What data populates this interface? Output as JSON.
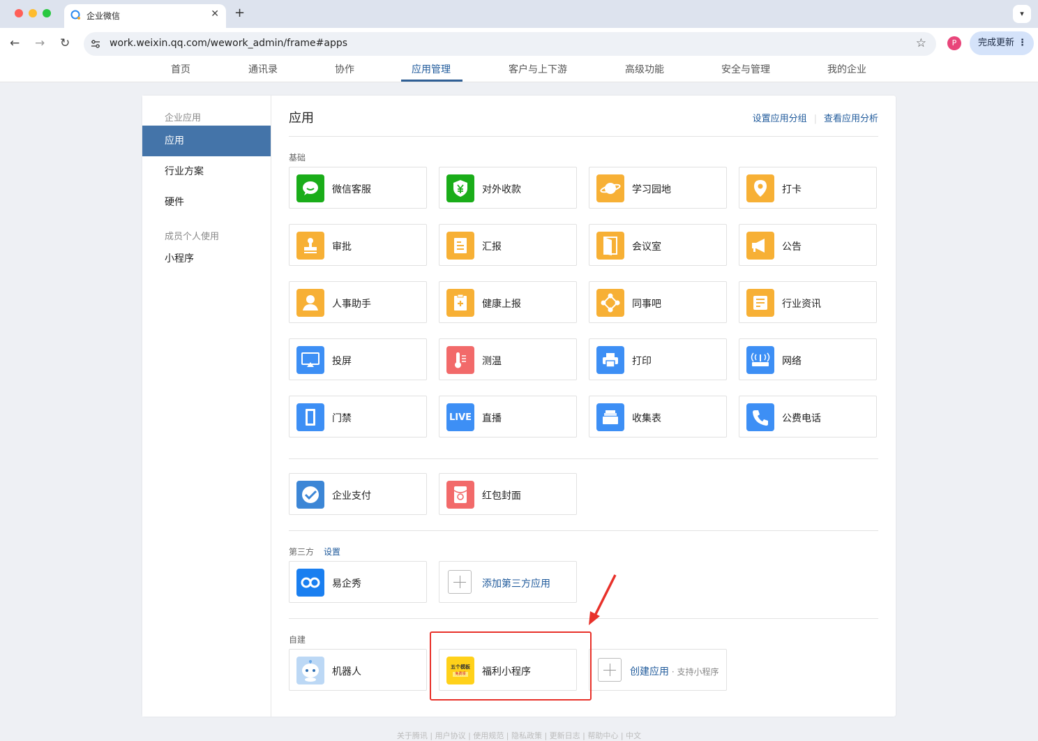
{
  "browser": {
    "tab_title": "企业微信",
    "url": "work.weixin.qq.com/wework_admin/frame#apps",
    "profile_initial": "P",
    "update_button": "完成更新"
  },
  "topnav": [
    "首页",
    "通讯录",
    "协作",
    "应用管理",
    "客户与上下游",
    "高级功能",
    "安全与管理",
    "我的企业"
  ],
  "sidebar": {
    "group1": "企业应用",
    "items": [
      "应用",
      "行业方案",
      "硬件"
    ],
    "group2": "成员个人使用",
    "item_mini": "小程序"
  },
  "main": {
    "title": "应用",
    "link_group": "设置应用分组",
    "link_analysis": "查看应用分析",
    "section_basic": "基础",
    "basic_apps": [
      "微信客服",
      "对外收款",
      "学习园地",
      "打卡",
      "审批",
      "汇报",
      "会议室",
      "公告",
      "人事助手",
      "健康上报",
      "同事吧",
      "行业资讯",
      "投屏",
      "测温",
      "打印",
      "网络",
      "门禁",
      "直播",
      "收集表",
      "公费电话"
    ],
    "pay_apps": [
      "企业支付",
      "红包封面"
    ],
    "section_third": "第三方",
    "third_settings": "设置",
    "third_apps": [
      "易企秀"
    ],
    "add_third": "添加第三方应用",
    "section_custom": "自建",
    "custom_apps": [
      "机器人",
      "福利小程序"
    ],
    "create_app": "创建应用",
    "create_app_sub": " · 支持小程序",
    "live_badge": "LIVE",
    "welfare_icon_text": "五个模板",
    "welfare_icon_sub": "免费领"
  },
  "colors": {
    "accent": "#4474a9",
    "link": "#1f5a9b",
    "green": "#1aad19",
    "orange": "#f7b035",
    "blue": "#3d8ff5",
    "red": "#f26a6a",
    "highlight": "#e8312a"
  },
  "footer": "关于腾讯 | 用户协议 | 使用规范 | 隐私政策 | 更新日志 | 帮助中心 | 中文"
}
